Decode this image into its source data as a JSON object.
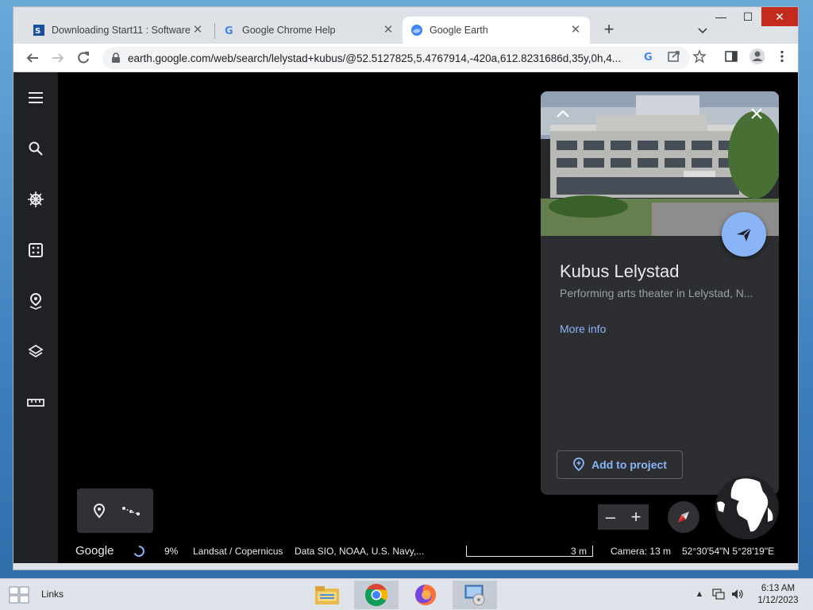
{
  "browser": {
    "tabs": [
      {
        "title": "Downloading Start11 : Software",
        "icon": "start11-icon"
      },
      {
        "title": "Google Chrome Help",
        "icon": "google-g-icon"
      },
      {
        "title": "Google Earth",
        "icon": "google-earth-icon",
        "active": true
      }
    ],
    "url": "earth.google.com/web/search/lelystad+kubus/@52.5127825,5.4767914,-420a,612.8231686d,35y,0h,4..."
  },
  "earth": {
    "place": {
      "title": "Kubus Lelystad",
      "subtitle": "Performing arts theater in Lelystad, N...",
      "more_info": "More info",
      "add_to_project": "Add to project"
    },
    "status": {
      "logo": "Google",
      "loading": "9%",
      "attribution1": "Landsat / Copernicus",
      "attribution2": "Data SIO, NOAA, U.S. Navy,...",
      "scale": "3 m",
      "camera": "Camera: 13 m",
      "coords": "52°30'54\"N 5°28'19\"E"
    },
    "zoom_out": "–",
    "zoom_in": "+"
  },
  "taskbar": {
    "links": "Links",
    "time": "6:13 AM",
    "date": "1/12/2023"
  },
  "colors": {
    "accent": "#8ab4f8",
    "panel": "#2d2e31",
    "rail": "#202124"
  }
}
